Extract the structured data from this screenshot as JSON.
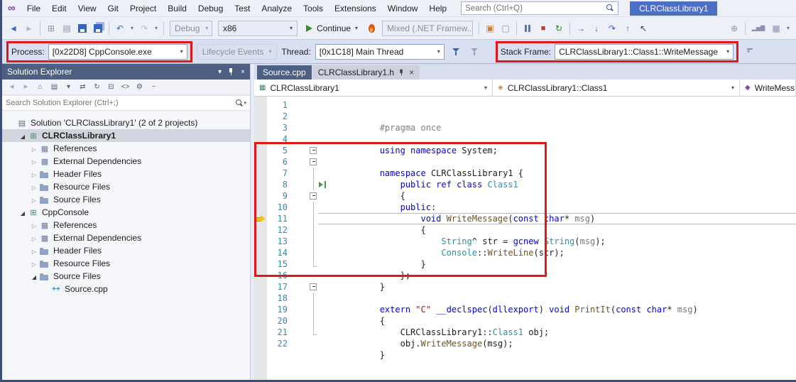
{
  "colors": {
    "annotation_red": "#e21717",
    "accent_blue": "#4b6ec6",
    "panel_slate": "#4d6082",
    "keyword_blue": "#0000ff",
    "type_teal": "#2b91af"
  },
  "icons": {
    "logo": "∞",
    "caret": "▾",
    "close": "×"
  },
  "title_bar": {
    "menus": [
      {
        "label": "File",
        "name": "menu-file"
      },
      {
        "label": "Edit",
        "name": "menu-edit"
      },
      {
        "label": "View",
        "name": "menu-view"
      },
      {
        "label": "Git",
        "name": "menu-git"
      },
      {
        "label": "Project",
        "name": "menu-project"
      },
      {
        "label": "Build",
        "name": "menu-build"
      },
      {
        "label": "Debug",
        "name": "menu-debug"
      },
      {
        "label": "Test",
        "name": "menu-test"
      },
      {
        "label": "Analyze",
        "name": "menu-analyze"
      },
      {
        "label": "Tools",
        "name": "menu-tools"
      },
      {
        "label": "Extensions",
        "name": "menu-extensions"
      },
      {
        "label": "Window",
        "name": "menu-window"
      },
      {
        "label": "Help",
        "name": "menu-help"
      }
    ],
    "search_placeholder": "Search (Ctrl+Q)",
    "window_title": "CLRClassLibrary1"
  },
  "toolbar": {
    "left_icons": [
      {
        "g": "◄",
        "cls": "tbi blue",
        "name": "nav-back-icon",
        "it": "true"
      },
      {
        "g": "►",
        "cls": "tbi dis",
        "name": "nav-forward-icon",
        "it": "true"
      },
      {
        "g": "",
        "cls": "tsep",
        "name": "toolbar-separator",
        "it": "false"
      },
      {
        "g": "⊞",
        "cls": "tbi dim",
        "name": "new-project-icon",
        "it": "true"
      },
      {
        "g": "▤",
        "cls": "tbi dim",
        "name": "add-item-icon",
        "it": "true"
      },
      {
        "g": "",
        "cls": "tbi floppy",
        "name": "save-icon",
        "it": "true"
      },
      {
        "g": "",
        "cls": "tbi floppy all",
        "name": "save-all-icon",
        "it": "true"
      },
      {
        "g": "",
        "cls": "tsep",
        "name": "toolbar-separator",
        "it": "false"
      },
      {
        "g": "↶",
        "cls": "tbi blue",
        "name": "undo-icon",
        "it": "true"
      },
      {
        "g": "▾",
        "cls": "tbi caret",
        "name": "undo-dropdown-icon",
        "it": "true"
      },
      {
        "g": "↷",
        "cls": "tbi dis",
        "name": "redo-icon",
        "it": "true"
      },
      {
        "g": "▾",
        "cls": "tbi caret",
        "name": "redo-dropdown-icon",
        "it": "true"
      },
      {
        "g": "",
        "cls": "tsep",
        "name": "toolbar-separator",
        "it": "false"
      }
    ],
    "debug_config": "Debug",
    "platform": "x86",
    "continue_label": "Continue",
    "framework_mode": "Mixed (.NET Framew...",
    "exec_icons": [
      {
        "g": "",
        "cls": "tsep",
        "name": "toolbar-separator",
        "it": "false"
      },
      {
        "g": "▣",
        "cls": "tbi orange",
        "name": "diagnostic-tools-icon",
        "it": "true"
      },
      {
        "g": "▢",
        "cls": "tbi dim",
        "name": "screenshot-icon",
        "it": "true"
      },
      {
        "g": "",
        "cls": "tsep",
        "name": "toolbar-separator",
        "it": "false"
      },
      {
        "g": "",
        "cls": "tbi pausei",
        "name": "break-all-icon",
        "it": "true"
      },
      {
        "g": "■",
        "cls": "tbi red",
        "name": "stop-debugging-icon",
        "it": "true"
      },
      {
        "g": "↻",
        "cls": "tbi green",
        "name": "restart-icon",
        "it": "true"
      },
      {
        "g": "",
        "cls": "tsep",
        "name": "toolbar-separator",
        "it": "false"
      },
      {
        "g": "→",
        "cls": "tbi blue",
        "name": "show-next-statement-icon",
        "it": "true"
      },
      {
        "g": "↓",
        "cls": "tbi blue",
        "name": "step-into-icon",
        "it": "true"
      },
      {
        "g": "↷",
        "cls": "tbi blue",
        "name": "step-over-icon",
        "it": "true"
      },
      {
        "g": "↑",
        "cls": "tbi blue",
        "name": "step-out-icon",
        "it": "true"
      },
      {
        "g": "↖",
        "cls": "tbi dark",
        "name": "run-to-click-icon",
        "it": "true"
      }
    ],
    "right_icons": [
      {
        "g": "⊕",
        "cls": "tbi dim",
        "name": "feedback-icon",
        "it": "true"
      },
      {
        "g": "",
        "cls": "tsep",
        "name": "toolbar-separator",
        "it": "false"
      },
      {
        "g": "▂▅▇",
        "cls": "tbi dim wide",
        "name": "performance-chart-icon",
        "it": "true"
      },
      {
        "g": "▦",
        "cls": "tbi dim",
        "name": "memory-usage-icon",
        "it": "true"
      },
      {
        "g": "▾",
        "cls": "tbi caret",
        "name": "toolbar-overflow-icon",
        "it": "true"
      }
    ]
  },
  "debug_bar": {
    "process_label": "Process:",
    "process_value": "[0x22D8] CppConsole.exe",
    "lifecycle_label": "Lifecycle Events",
    "thread_label": "Thread:",
    "thread_value": "[0x1C18] Main Thread",
    "stack_frame_label": "Stack Frame:",
    "stack_frame_value": "CLRClassLibrary1::Class1::WriteMessage"
  },
  "solution_explorer": {
    "title": "Solution Explorer",
    "search_placeholder": "Search Solution Explorer (Ctrl+;)",
    "toolbar_icons": [
      {
        "g": "◄",
        "cls": "sei dim",
        "name": "se-back-icon"
      },
      {
        "g": "►",
        "cls": "sei dim",
        "name": "se-forward-icon"
      },
      {
        "g": "⌂",
        "cls": "sei",
        "name": "se-home-icon"
      },
      {
        "g": "▤",
        "cls": "sei",
        "name": "se-switch-views-icon"
      },
      {
        "g": "▾",
        "cls": "sei",
        "name": "se-filter-dropdown-icon"
      },
      {
        "g": "⇄",
        "cls": "sei",
        "name": "se-sync-icon"
      },
      {
        "g": "↻",
        "cls": "sei",
        "name": "se-refresh-icon"
      },
      {
        "g": "⊟",
        "cls": "sei",
        "name": "se-collapse-all-icon"
      },
      {
        "g": "<>",
        "cls": "sei",
        "name": "se-view-code-icon"
      },
      {
        "g": "⚙",
        "cls": "sei",
        "name": "se-properties-icon"
      },
      {
        "g": "−",
        "cls": "sei",
        "name": "se-preview-icon"
      }
    ],
    "tree": [
      {
        "cls": "trow d0",
        "acls": "arrow",
        "icls": "ticon t-solution",
        "iname": "solution-icon",
        "label": "Solution 'CLRClassLibrary1' (2 of 2 projects)",
        "name": "tree-item-solution"
      },
      {
        "cls": "trow d1 selected boldrow",
        "acls": "arrow exp",
        "icls": "ticon t-project",
        "iname": "project-icon",
        "label": "CLRClassLibrary1",
        "name": "tree-item-project-clrclasslibrary1"
      },
      {
        "cls": "trow d2",
        "acls": "arrow col",
        "icls": "ticon t-refs",
        "iname": "references-icon",
        "label": "References",
        "name": "tree-item-references"
      },
      {
        "cls": "trow d2",
        "acls": "arrow col",
        "icls": "ticon t-deps",
        "iname": "external-dependencies-icon",
        "label": "External Dependencies",
        "name": "tree-item-external-dependencies"
      },
      {
        "cls": "trow d2",
        "acls": "arrow col",
        "icls": "ticon t-filter",
        "iname": "folder-icon",
        "label": "Header Files",
        "name": "tree-item-header-files"
      },
      {
        "cls": "trow d2",
        "acls": "arrow col",
        "icls": "ticon t-filter",
        "iname": "folder-icon",
        "label": "Resource Files",
        "name": "tree-item-resource-files"
      },
      {
        "cls": "trow d2",
        "acls": "arrow col",
        "icls": "ticon t-filter",
        "iname": "folder-icon",
        "label": "Source Files",
        "name": "tree-item-source-files"
      },
      {
        "cls": "trow d1",
        "acls": "arrow exp",
        "icls": "ticon t-project",
        "iname": "project-icon",
        "label": "CppConsole",
        "name": "tree-item-project-cppconsole"
      },
      {
        "cls": "trow d2",
        "acls": "arrow col",
        "icls": "ticon t-refs",
        "iname": "references-icon",
        "label": "References",
        "name": "tree-item-references"
      },
      {
        "cls": "trow d2",
        "acls": "arrow col",
        "icls": "ticon t-deps",
        "iname": "external-dependencies-icon",
        "label": "External Dependencies",
        "name": "tree-item-external-dependencies"
      },
      {
        "cls": "trow d2",
        "acls": "arrow col",
        "icls": "ticon t-filter",
        "iname": "folder-icon",
        "label": "Header Files",
        "name": "tree-item-header-files"
      },
      {
        "cls": "trow d2",
        "acls": "arrow col",
        "icls": "ticon t-filter",
        "iname": "folder-icon",
        "label": "Resource Files",
        "name": "tree-item-resource-files"
      },
      {
        "cls": "trow d2",
        "acls": "arrow exp",
        "icls": "ticon t-filter",
        "iname": "folder-icon",
        "label": "Source Files",
        "name": "tree-item-source-files"
      },
      {
        "cls": "trow d3",
        "acls": "arrow",
        "icls": "ticon t-cpp",
        "iname": "cpp-file-icon",
        "label": "Source.cpp",
        "name": "tree-item-source-cpp"
      }
    ]
  },
  "editor": {
    "tabs": [
      {
        "label": "Source.cpp",
        "cls": "tab t-dark",
        "name": "tab-source-cpp"
      },
      {
        "label": "CLRClassLibrary1.h",
        "cls": "tab t-light withctrl",
        "name": "tab-clrclasslibrary1-h"
      }
    ],
    "navbar": [
      {
        "label": "CLRClassLibrary1",
        "icls": "nvi nvi-project",
        "cls": "nav-combo nc1",
        "name": "navbar-project-dropdown"
      },
      {
        "label": "CLRClassLibrary1::Class1",
        "icls": "nvi nvi-class",
        "cls": "nav-combo nc2",
        "name": "navbar-type-dropdown"
      },
      {
        "label": "WriteMess",
        "icls": "nvi nvi-method",
        "cls": "nav-combo nc3",
        "name": "navbar-member-dropdown"
      }
    ],
    "code_lines": [
      {
        "n": "1",
        "cls": "code-line",
        "g": "gm",
        "f": "outline",
        "tokens": [
          {
            "t": "#pragma once",
            "c": "tok tk-pre"
          }
        ]
      },
      {
        "n": "2",
        "cls": "code-line",
        "g": "gm",
        "f": "outline",
        "tokens": []
      },
      {
        "n": "3",
        "cls": "code-line",
        "g": "gm",
        "f": "outline",
        "tokens": [
          {
            "t": "using namespace ",
            "c": "tok tk-kw"
          },
          {
            "t": "System;",
            "c": "tok tk-pln"
          }
        ]
      },
      {
        "n": "4",
        "cls": "code-line",
        "g": "gm",
        "f": "outline",
        "tokens": []
      },
      {
        "n": "5",
        "cls": "code-line",
        "g": "gm",
        "f": "outline fbox",
        "tokens": [
          {
            "t": "namespace ",
            "c": "tok tk-kw"
          },
          {
            "t": "CLRClassLibrary1 {",
            "c": "tok tk-pln"
          }
        ]
      },
      {
        "n": "6",
        "cls": "code-line",
        "g": "gm",
        "f": "outline fbox",
        "tokens": [
          {
            "t": "    ",
            "c": "tok tk-pln"
          },
          {
            "t": "public ref class ",
            "c": "tok tk-kw"
          },
          {
            "t": "Class1",
            "c": "tok tk-typ"
          }
        ]
      },
      {
        "n": "7",
        "cls": "code-line",
        "g": "gm",
        "f": "outline fline",
        "tokens": [
          {
            "t": "    {",
            "c": "tok tk-pln"
          }
        ]
      },
      {
        "n": "8",
        "cls": "code-line runmark",
        "g": "gm",
        "f": "outline fline",
        "tokens": [
          {
            "t": "    ",
            "c": "tok tk-pln"
          },
          {
            "t": "public",
            "c": "tok tk-kw"
          },
          {
            "t": ":",
            "c": "tok tk-pln"
          }
        ]
      },
      {
        "n": "9",
        "cls": "code-line",
        "g": "gm",
        "f": "outline fbox",
        "tokens": [
          {
            "t": "        ",
            "c": "tok tk-pln"
          },
          {
            "t": "void ",
            "c": "tok tk-kw"
          },
          {
            "t": "WriteMessage",
            "c": "tok tk-fn"
          },
          {
            "t": "(",
            "c": "tok tk-pln"
          },
          {
            "t": "const char",
            "c": "tok tk-kw"
          },
          {
            "t": "* ",
            "c": "tok tk-pln"
          },
          {
            "t": "msg",
            "c": "tok tk-prm"
          },
          {
            "t": ")",
            "c": "tok tk-pln"
          }
        ]
      },
      {
        "n": "10",
        "cls": "code-line",
        "g": "gm",
        "f": "outline fline",
        "tokens": [
          {
            "t": "        {",
            "c": "tok tk-pln"
          }
        ]
      },
      {
        "n": "11",
        "cls": "code-line current",
        "g": "gm exec",
        "f": "outline fline",
        "tokens": [
          {
            "t": "            ",
            "c": "tok tk-pln"
          },
          {
            "t": "String",
            "c": "tok tk-typ"
          },
          {
            "t": "^ str = ",
            "c": "tok tk-pln"
          },
          {
            "t": "gcnew",
            "c": "tok tk-kw"
          },
          {
            "t": " ",
            "c": "tok tk-pln"
          },
          {
            "t": "String",
            "c": "tok tk-typ"
          },
          {
            "t": "(",
            "c": "tok tk-pln"
          },
          {
            "t": "msg",
            "c": "tok tk-prm"
          },
          {
            "t": ");",
            "c": "tok tk-pln"
          }
        ]
      },
      {
        "n": "12",
        "cls": "code-line",
        "g": "gm",
        "f": "outline fline",
        "tokens": [
          {
            "t": "            ",
            "c": "tok tk-pln"
          },
          {
            "t": "Console",
            "c": "tok tk-typ"
          },
          {
            "t": "::",
            "c": "tok tk-pln"
          },
          {
            "t": "WriteLine",
            "c": "tok tk-fn"
          },
          {
            "t": "(str);",
            "c": "tok tk-pln"
          }
        ]
      },
      {
        "n": "13",
        "cls": "code-line",
        "g": "gm",
        "f": "outline fline",
        "tokens": [
          {
            "t": "        }",
            "c": "tok tk-pln"
          }
        ]
      },
      {
        "n": "14",
        "cls": "code-line",
        "g": "gm",
        "f": "outline fline",
        "tokens": [
          {
            "t": "    };",
            "c": "tok tk-pln"
          }
        ]
      },
      {
        "n": "15",
        "cls": "code-line",
        "g": "gm",
        "f": "outline fend",
        "tokens": [
          {
            "t": "}",
            "c": "tok tk-pln"
          }
        ]
      },
      {
        "n": "16",
        "cls": "code-line",
        "g": "gm",
        "f": "outline",
        "tokens": []
      },
      {
        "n": "17",
        "cls": "code-line",
        "g": "gm",
        "f": "outline fbox",
        "tokens": [
          {
            "t": "extern ",
            "c": "tok tk-kw"
          },
          {
            "t": "\"C\" ",
            "c": "tok tk-str"
          },
          {
            "t": "__declspec",
            "c": "tok tk-kw"
          },
          {
            "t": "(",
            "c": "tok tk-pln"
          },
          {
            "t": "dllexport",
            "c": "tok tk-kw"
          },
          {
            "t": ") ",
            "c": "tok tk-pln"
          },
          {
            "t": "void ",
            "c": "tok tk-kw"
          },
          {
            "t": "PrintIt",
            "c": "tok tk-fn"
          },
          {
            "t": "(",
            "c": "tok tk-pln"
          },
          {
            "t": "const char",
            "c": "tok tk-kw"
          },
          {
            "t": "* ",
            "c": "tok tk-pln"
          },
          {
            "t": "msg",
            "c": "tok tk-prm"
          },
          {
            "t": ")",
            "c": "tok tk-pln"
          }
        ]
      },
      {
        "n": "18",
        "cls": "code-line",
        "g": "gm",
        "f": "outline fline",
        "tokens": [
          {
            "t": "{",
            "c": "tok tk-pln"
          }
        ]
      },
      {
        "n": "19",
        "cls": "code-line",
        "g": "gm",
        "f": "outline fline",
        "tokens": [
          {
            "t": "    CLRClassLibrary1",
            "c": "tok tk-pln"
          },
          {
            "t": "::",
            "c": "tok tk-pln"
          },
          {
            "t": "Class1",
            "c": "tok tk-typ"
          },
          {
            "t": " obj;",
            "c": "tok tk-pln"
          }
        ]
      },
      {
        "n": "20",
        "cls": "code-line",
        "g": "gm",
        "f": "outline fline",
        "tokens": [
          {
            "t": "    obj.",
            "c": "tok tk-pln"
          },
          {
            "t": "WriteMessage",
            "c": "tok tk-fn"
          },
          {
            "t": "(msg);",
            "c": "tok tk-pln"
          }
        ]
      },
      {
        "n": "21",
        "cls": "code-line",
        "g": "gm",
        "f": "outline fend",
        "tokens": [
          {
            "t": "}",
            "c": "tok tk-pln"
          }
        ]
      },
      {
        "n": "22",
        "cls": "code-line",
        "g": "gm",
        "f": "outline",
        "tokens": []
      }
    ]
  }
}
